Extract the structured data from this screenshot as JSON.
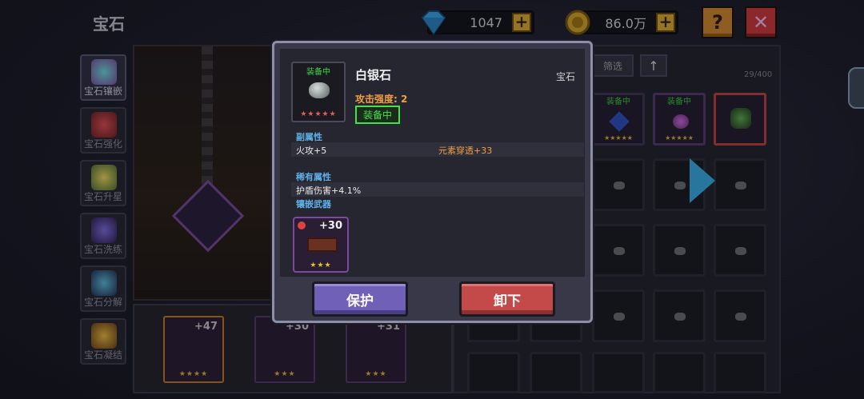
{
  "header": {
    "title": "宝石",
    "diamonds": "1047",
    "coins": "86.0万",
    "plus_label": "+",
    "help_label": "?",
    "close_label": "✕"
  },
  "sidebar": {
    "items": [
      {
        "label": "宝石镶嵌",
        "icon": "gem-inlay-icon",
        "active": true
      },
      {
        "label": "宝石强化",
        "icon": "gem-enhance-icon",
        "active": false
      },
      {
        "label": "宝石升星",
        "icon": "gem-star-icon",
        "active": false
      },
      {
        "label": "宝石洗练",
        "icon": "gem-refine-icon",
        "active": false
      },
      {
        "label": "宝石分解",
        "icon": "gem-decompose-icon",
        "active": false
      },
      {
        "label": "宝石凝结",
        "icon": "gem-condense-icon",
        "active": false
      }
    ]
  },
  "bottom_strip": {
    "weapons": [
      {
        "level": "+47",
        "stars": "★★★★"
      },
      {
        "level": "+30",
        "stars": "★★★"
      },
      {
        "level": "+31",
        "stars": "★★★"
      }
    ]
  },
  "inventory": {
    "filter_label": "筛选",
    "sort_label": "↑",
    "capacity": "29/400",
    "equipped_tag": "装备中",
    "stars": "★★★★★"
  },
  "popup": {
    "equipped_tag": "装备中",
    "item_stars": "★★★★★",
    "item_name": "白银石",
    "item_type": "宝石",
    "attack": "攻击强度: 2",
    "equipped_badge": "装备中",
    "secondary_header": "副属性",
    "secondary_left": "火攻+5",
    "secondary_right": "元素穿透+33",
    "rare_header": "稀有属性",
    "rare_value": "护盾伤害+4.1%",
    "inlaid_header": "镶嵌武器",
    "weapon_level": "+30",
    "weapon_stars": "★★★",
    "protect_label": "保护",
    "unequip_label": "卸下"
  },
  "colors": {
    "accent_blue": "#3ab0e8",
    "equipped_green": "#42d84a",
    "attack_orange": "#f0a040",
    "protect_purple": "#7060b8",
    "unequip_red": "#c44a4a"
  }
}
